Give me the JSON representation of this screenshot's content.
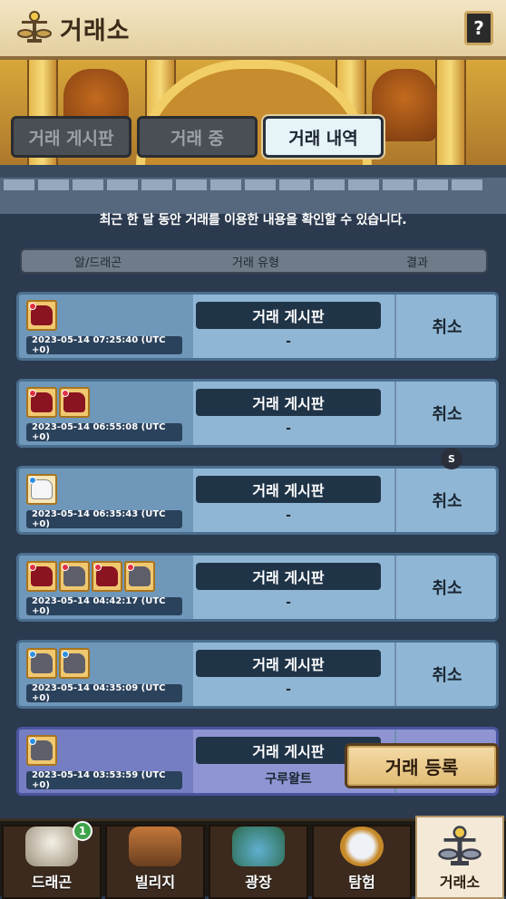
{
  "header": {
    "title": "거래소",
    "help_label": "?"
  },
  "tabs": [
    {
      "label": "거래 게시판",
      "active": false
    },
    {
      "label": "거래 중",
      "active": false
    },
    {
      "label": "거래 내역",
      "active": true
    }
  ],
  "info_text": "최근 한 달 동안 거래를 이용한 내용을 확인할 수 있습니다.",
  "columns": {
    "item": "알/드래곤",
    "type": "거래 유형",
    "result": "결과"
  },
  "items": [
    {
      "timestamp": "2023-05-14 07:25:40 (UTC +0)",
      "type": "거래 게시판",
      "detail": "-",
      "result": "취소",
      "eggs": [
        "red"
      ]
    },
    {
      "timestamp": "2023-05-14 06:55:08 (UTC +0)",
      "type": "거래 게시판",
      "detail": "-",
      "result": "취소",
      "eggs": [
        "red",
        "red"
      ]
    },
    {
      "timestamp": "2023-05-14 06:35:43 (UTC +0)",
      "type": "거래 게시판",
      "detail": "-",
      "result": "취소",
      "eggs": [
        "white"
      ]
    },
    {
      "timestamp": "2023-05-14 04:42:17 (UTC +0)",
      "type": "거래 게시판",
      "detail": "-",
      "result": "취소",
      "eggs": [
        "red",
        "grey",
        "red",
        "grey"
      ]
    },
    {
      "timestamp": "2023-05-14 04:35:09 (UTC +0)",
      "type": "거래 게시판",
      "detail": "-",
      "result": "취소",
      "eggs": [
        "grey",
        "grey"
      ]
    },
    {
      "timestamp": "2023-05-14 03:53:59 (UTC +0)",
      "type": "거래 게시판",
      "detail": "구루왈트",
      "result": "",
      "eggs": [
        "grey"
      ]
    }
  ],
  "s_badge": "S",
  "register_button": "거래 등록",
  "nav": [
    {
      "label": "드래곤",
      "badge": "1",
      "icon": "dragon-icon"
    },
    {
      "label": "빌리지",
      "icon": "village-icon"
    },
    {
      "label": "광장",
      "icon": "plaza-icon"
    },
    {
      "label": "탐험",
      "icon": "compass-icon"
    },
    {
      "label": "거래소",
      "icon": "exchange-icon",
      "active": true
    }
  ]
}
